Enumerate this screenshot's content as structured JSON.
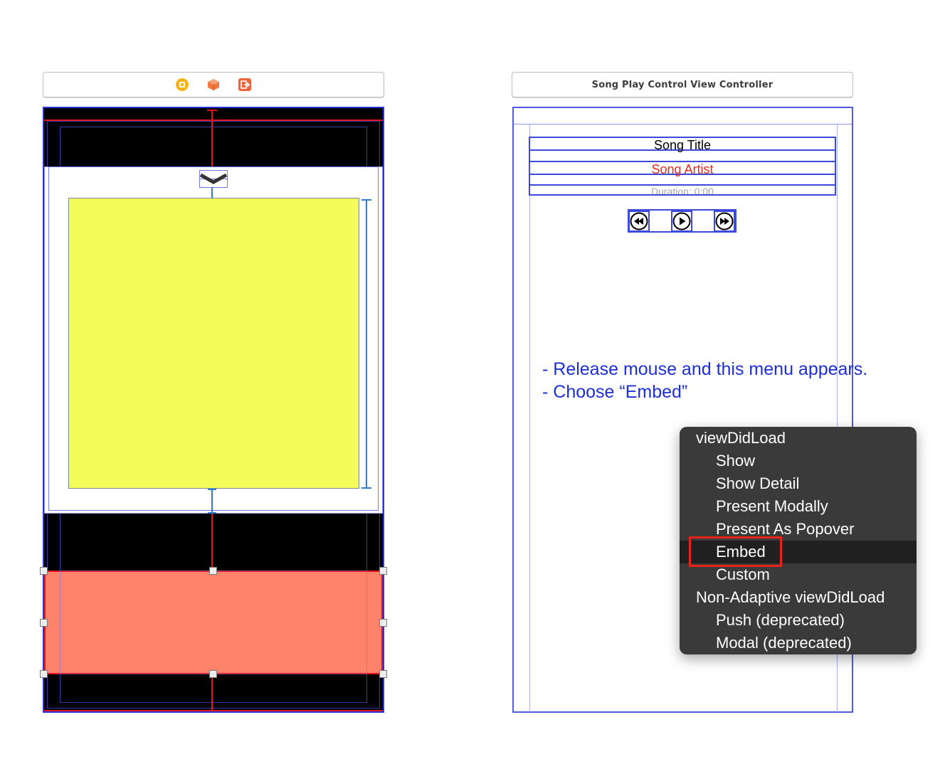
{
  "left_scene": {
    "dock_icons": [
      "first-responder-icon",
      "scene-object-icon",
      "exit-icon"
    ],
    "colors": {
      "top_view": "#000000",
      "content_view": "#f2fd5a",
      "bottom_view": "#ff826b",
      "chevron": "#333333"
    }
  },
  "right_scene": {
    "dock_title": "Song Play Control View Controller",
    "song_title": "Song Title",
    "song_artist": "Song Artist",
    "duration": "Duration: 0:00",
    "controls": [
      "rewind-icon",
      "play-icon",
      "fast-forward-icon"
    ]
  },
  "instructions": {
    "line1": "- Release mouse and this menu appears.",
    "line2": "- Choose “Embed”"
  },
  "menu": {
    "items": [
      {
        "label": "viewDidLoad",
        "type": "head"
      },
      {
        "label": "Show",
        "type": "sub"
      },
      {
        "label": "Show Detail",
        "type": "sub"
      },
      {
        "label": "Present Modally",
        "type": "sub"
      },
      {
        "label": "Present As Popover",
        "type": "sub"
      },
      {
        "label": "Embed",
        "type": "sub",
        "selected": true
      },
      {
        "label": "Custom",
        "type": "sub"
      },
      {
        "label": "Non-Adaptive viewDidLoad",
        "type": "head"
      },
      {
        "label": "Push (deprecated)",
        "type": "sub"
      },
      {
        "label": "Modal (deprecated)",
        "type": "sub"
      }
    ]
  }
}
